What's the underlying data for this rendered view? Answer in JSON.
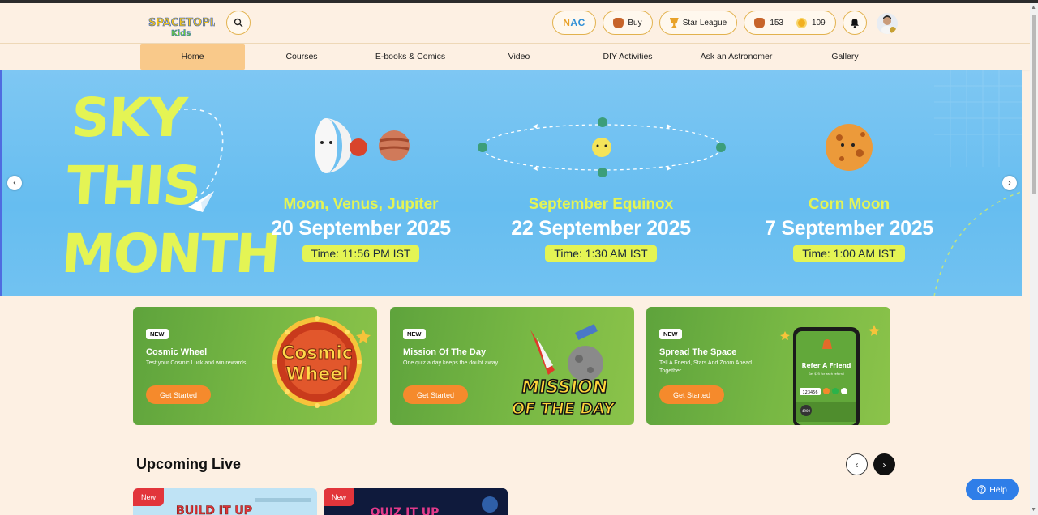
{
  "header": {
    "logo_text": "SPACETOPIA KIDS",
    "nac_label_part1": "N",
    "nac_label_part2": "AC",
    "buy_label": "Buy",
    "star_league_label": "Star League",
    "bag_count": "153",
    "coin_count": "109"
  },
  "nav": {
    "items": [
      {
        "label": "Home"
      },
      {
        "label": "Courses"
      },
      {
        "label": "E-books & Comics"
      },
      {
        "label": "Video"
      },
      {
        "label": "DIY Activities"
      },
      {
        "label": "Ask an Astronomer"
      },
      {
        "label": "Gallery"
      }
    ]
  },
  "banner": {
    "title_line1": "SKY",
    "title_line2": "THIS",
    "title_line3": "MONTH",
    "events": [
      {
        "name": "Moon, Venus, Jupiter",
        "date": "20 September 2025",
        "time": "Time: 11:56 PM IST"
      },
      {
        "name": "September Equinox",
        "date": "22 September 2025",
        "time": "Time: 1:30 AM IST"
      },
      {
        "name": "Corn Moon",
        "date": "7 September 2025",
        "time": "Time: 1:00 AM IST"
      }
    ]
  },
  "cards": [
    {
      "badge": "NEW",
      "title": "Cosmic Wheel",
      "desc": "Test your Cosmic Luck and win rewards",
      "button": "Get Started",
      "art_text1": "Cosmic",
      "art_text2": "Wheel"
    },
    {
      "badge": "NEW",
      "title": "Mission Of The Day",
      "desc": "One quiz a day keeps the doubt away",
      "button": "Get Started",
      "art_text1": "MISSION",
      "art_text2": "OF THE DAY"
    },
    {
      "badge": "NEW",
      "title": "Spread The Space",
      "desc": "Tell A Friend, Stars And Zoom Ahead Together",
      "button": "Get Started",
      "phone_title": "Refer A Friend",
      "phone_sub": "Get $25 for each referral",
      "phone_code": "123456",
      "phone_stars": "4900"
    }
  ],
  "upcoming": {
    "title": "Upcoming Live",
    "cards": [
      {
        "badge": "New",
        "art_text": "BUILD IT UP"
      },
      {
        "badge": "New",
        "art_text": "QUIZ IT UP"
      }
    ]
  },
  "help": {
    "label": "Help"
  },
  "colors": {
    "accent": "#e4f454",
    "card_green": "#78b844",
    "button_orange": "#f58a2c",
    "banner_blue": "#6ec0f1",
    "help_blue": "#2f7ee8",
    "nav_active": "#f9c98a"
  }
}
